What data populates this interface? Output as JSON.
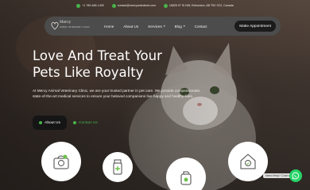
{
  "topbar": {
    "phone": "+1 780-466-1400",
    "email": "contact@mercyanimalvet.com",
    "address": "15825 97 St NW, Edmonton, AB T5X 0C2, Canada"
  },
  "logo": {
    "name": "Mercy",
    "tagline": "ANIMAL VETERINARY CLINIC"
  },
  "nav": {
    "items": [
      {
        "label": "Home"
      },
      {
        "label": "About Us"
      },
      {
        "label": "Services",
        "dropdown": true
      },
      {
        "label": "Blog",
        "dropdown": true
      },
      {
        "label": "Contact"
      }
    ],
    "cta": "Make Appointment"
  },
  "hero": {
    "title_line1": "Love And Treat Your",
    "title_line2": "Pets Like Royalty",
    "description": "At Mercy Animal Veterinary Clinic, we are your trusted partner in pet care. We provide compassionate, state-of-the-art medical services to ensure your beloved companions live happy and healthy lives.",
    "about_button": "About Us",
    "contact_button": "Contact Us"
  },
  "services": [
    {
      "icon": "cat-carrier-icon"
    },
    {
      "icon": "medicine-bottle-icon"
    },
    {
      "icon": "pet-shampoo-icon"
    },
    {
      "icon": "pet-house-icon"
    }
  ],
  "chat": {
    "label": "Need Help? Chat with us",
    "icon": "whatsapp-icon"
  },
  "colors": {
    "accent_green": "#49b34a",
    "nav_bg": "#4c4c4c",
    "button_dark": "#151515"
  }
}
